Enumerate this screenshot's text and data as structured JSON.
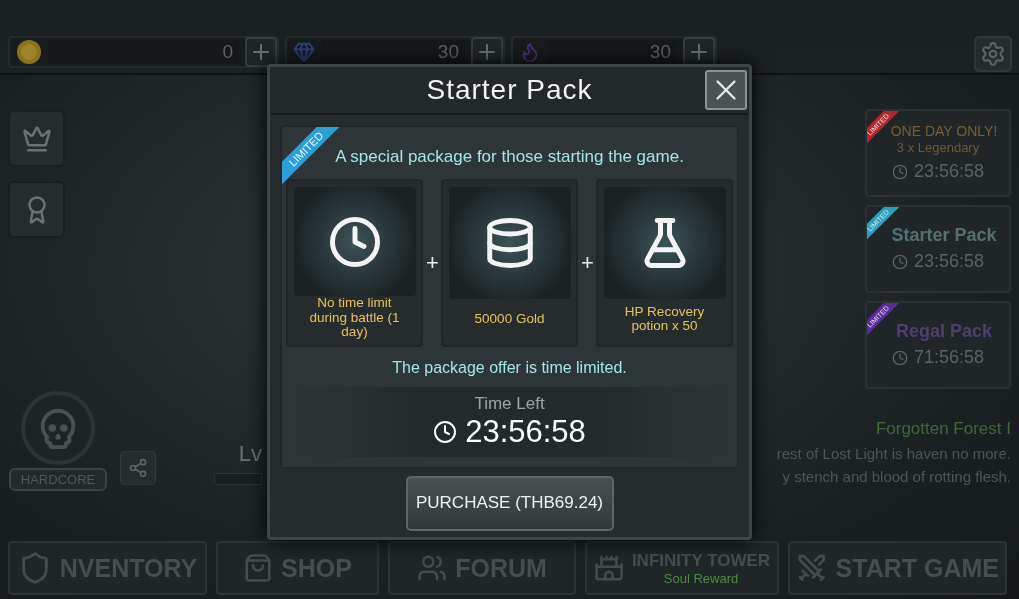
{
  "top_bar": {
    "currencies": [
      {
        "kind": "gold",
        "value": "0"
      },
      {
        "kind": "gem",
        "value": "30"
      },
      {
        "kind": "soul",
        "value": "30"
      }
    ]
  },
  "player": {
    "mode": "HARDCORE",
    "level_label": "Lv"
  },
  "offers": [
    {
      "kind": "legendary",
      "color": "#b3262b",
      "badge": "LIMITED",
      "title": "ONE DAY ONLY!",
      "subtitle": "3 x Legendary",
      "timer": "23:56:58"
    },
    {
      "kind": "starter",
      "color": "#2a9fc0",
      "badge": "LIMITED",
      "title": "Starter Pack",
      "timer": "23:56:58"
    },
    {
      "kind": "regal",
      "color": "#5a2c9a",
      "badge": "LIMITED",
      "title": "Regal Pack",
      "timer": "71:56:58"
    }
  ],
  "stage": {
    "title": "Forgotten Forest I",
    "description": [
      "rest of Lost Light is haven no more.",
      "y stench and blood of rotting flesh."
    ]
  },
  "modal": {
    "title": "Starter Pack",
    "ribbon": "LIMITED",
    "intro": "A special package for those starting the game.",
    "items": [
      {
        "kind": "clock",
        "label": "No time limit during battle (1 day)"
      },
      {
        "kind": "coins",
        "label": "50000 Gold"
      },
      {
        "kind": "potion",
        "label": "HP Recovery potion x 50"
      }
    ],
    "joiners": [
      "+",
      "+"
    ],
    "notice": "The package offer is time limited.",
    "time_left_label": "Time Left",
    "timer": "23:56:58",
    "purchase": "PURCHASE (THB69.24)"
  },
  "nav": [
    {
      "kind": "inventory",
      "label": "NVENTORY"
    },
    {
      "kind": "shop",
      "label": "SHOP"
    },
    {
      "kind": "forum",
      "label": "FORUM"
    },
    {
      "kind": "tower",
      "label": "INFINITY TOWER",
      "sublabel": "Soul Reward"
    },
    {
      "kind": "start",
      "label": "START GAME"
    }
  ]
}
